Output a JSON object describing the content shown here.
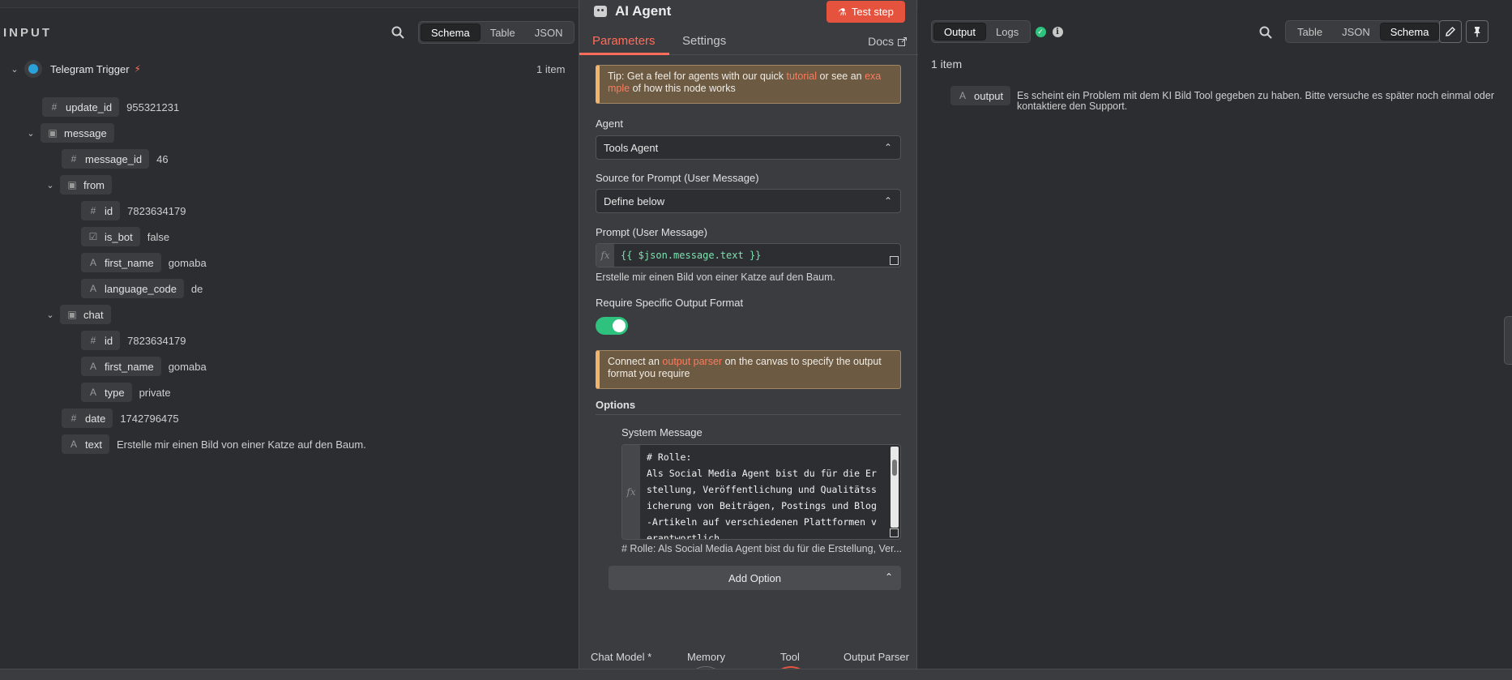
{
  "input": {
    "title": "INPUT",
    "view_tabs": [
      "Schema",
      "Table",
      "JSON"
    ],
    "active_view": "Schema",
    "trigger": {
      "name": "Telegram Trigger",
      "count": "1 item"
    },
    "fields": [
      {
        "key": "update_id",
        "type": "#",
        "value": "955321231"
      },
      {
        "key": "message",
        "type": "obj",
        "value": ""
      },
      {
        "key": "message_id",
        "type": "#",
        "value": "46"
      },
      {
        "key": "from",
        "type": "obj",
        "value": ""
      },
      {
        "key": "id",
        "type": "#",
        "value": "7823634179"
      },
      {
        "key": "is_bot",
        "type": "bool",
        "value": "false"
      },
      {
        "key": "first_name",
        "type": "A",
        "value": "gomaba"
      },
      {
        "key": "language_code",
        "type": "A",
        "value": "de"
      },
      {
        "key": "chat",
        "type": "obj",
        "value": ""
      },
      {
        "key": "id",
        "type": "#",
        "value": "7823634179"
      },
      {
        "key": "first_name",
        "type": "A",
        "value": "gomaba"
      },
      {
        "key": "type",
        "type": "A",
        "value": "private"
      },
      {
        "key": "date",
        "type": "#",
        "value": "1742796475"
      },
      {
        "key": "text",
        "type": "A",
        "value": "Erstelle mir einen Bild von einer Katze auf den Baum."
      }
    ]
  },
  "node": {
    "title": "AI Agent",
    "test_step": "Test step",
    "tabs": {
      "parameters": "Parameters",
      "settings": "Settings",
      "docs": "Docs"
    },
    "tip": {
      "pre": "Tip: Get a feel for agents with our quick ",
      "link1": "tutorial",
      "mid": " or see an ",
      "link2": "exa mple",
      "post": " of how this node works"
    },
    "agent_label": "Agent",
    "agent_value": "Tools Agent",
    "source_label": "Source for Prompt (User Message)",
    "source_value": "Define below",
    "prompt_label": "Prompt (User Message)",
    "prompt_expr": "{{ $json.message.text }}",
    "prompt_preview": "Erstelle mir einen Bild von einer Katze auf den Baum.",
    "require_label": "Require Specific Output Format",
    "require_on": true,
    "parser_notice": {
      "pre": "Connect an ",
      "link": "output parser",
      "post": " on the canvas to specify the output format you require"
    },
    "options_label": "Options",
    "system_label": "System Message",
    "system_text": "# Rolle:\nAls Social Media Agent bist du für die Erstellung, Veröffentlichung und Qualitätssicherung von Beiträgen, Postings und Blog-Artikeln auf verschiedenen Plattformen verantwortlich.\nDu überwachst und koordinierst alle Content-A",
    "system_preview": "# Rolle: Als Social Media Agent bist du für die Erstellung, Ver...",
    "add_option": "Add Option",
    "connectors": [
      "Chat Model *",
      "Memory",
      "Tool",
      "Output Parser"
    ]
  },
  "output": {
    "tabs": [
      "Output",
      "Logs"
    ],
    "active_tab": "Output",
    "view_tabs": [
      "Table",
      "JSON",
      "Schema"
    ],
    "active_view": "Schema",
    "count": "1 item",
    "field_key": "output",
    "field_value": "Es scheint ein Problem mit dem KI Bild Tool gegeben zu haben. Bitte versuche es später noch einmal oder kontaktiere den Support."
  },
  "colors": {
    "accent": "#ff6d5a",
    "success": "#2ec27e",
    "notice_bg": "#6c5a43"
  }
}
